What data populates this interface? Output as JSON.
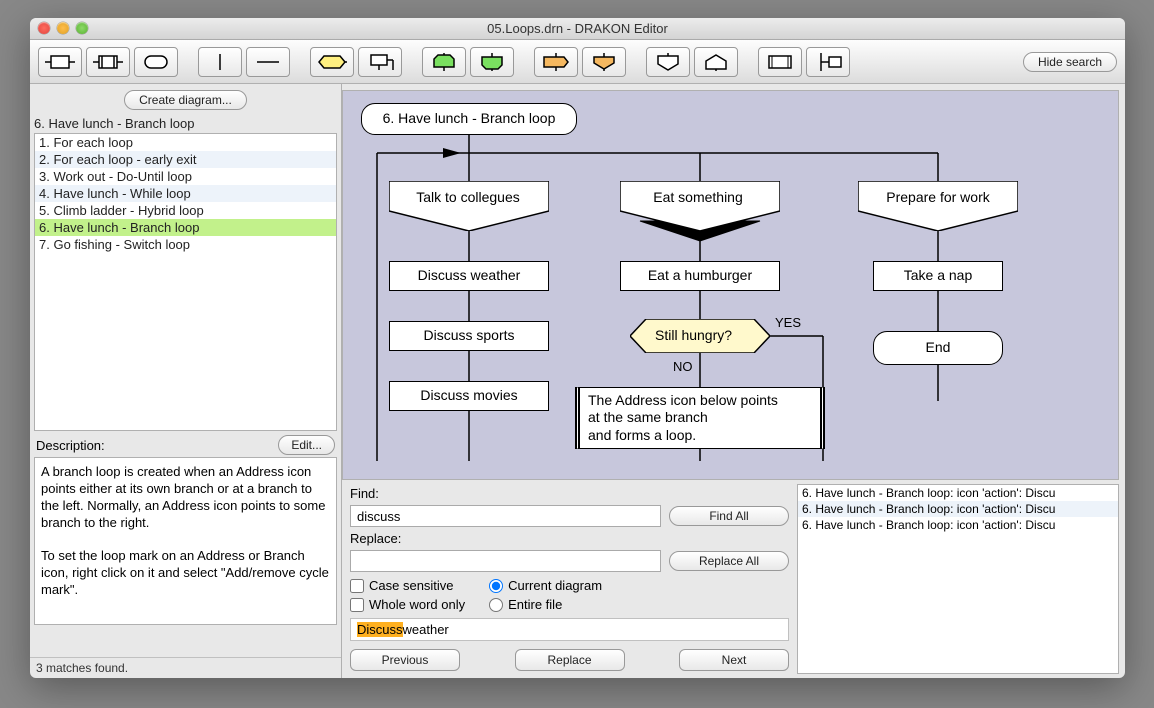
{
  "window": {
    "title": "05.Loops.drn - DRAKON Editor"
  },
  "toolbar": {
    "hide_search": "Hide search"
  },
  "sidebar": {
    "create_diagram": "Create diagram...",
    "filter": "6. Have lunch - Branch loop",
    "items": [
      "1. For each loop",
      "2. For each loop - early exit",
      "3. Work out - Do-Until loop",
      "4. Have lunch - While loop",
      "5. Climb ladder - Hybrid loop",
      "6. Have lunch - Branch loop",
      "7. Go fishing - Switch loop"
    ],
    "selected_index": 5,
    "description_label": "Description:",
    "edit_label": "Edit...",
    "description": "A branch loop is created when an Address icon points either at its own branch or at a branch to the left. Normally, an Address icon points to some branch to the right.\n\nTo set the loop mark on an Address or Branch icon, right click on it and select \"Add/remove cycle mark\"."
  },
  "status_bar": "3 matches found.",
  "diagram": {
    "title": "6. Have lunch - Branch loop",
    "branch1": {
      "head": "Talk to collegues",
      "a1": "Discuss weather",
      "a2": "Discuss sports",
      "a3": "Discuss movies"
    },
    "branch2": {
      "head": "Eat something",
      "a1": "Eat a humburger",
      "q": "Still hungry?",
      "yes": "YES",
      "no": "NO",
      "comment": "The Address icon below points\nat the same branch\nand forms a loop."
    },
    "branch3": {
      "head": "Prepare for work",
      "a1": "Take a nap",
      "end": "End"
    }
  },
  "find": {
    "find_label": "Find:",
    "find_value": "discuss",
    "replace_label": "Replace:",
    "replace_value": "",
    "find_all": "Find All",
    "replace_all": "Replace All",
    "case_sensitive": "Case sensitive",
    "whole_word": "Whole word only",
    "current_diagram": "Current diagram",
    "entire_file": "Entire file",
    "match_highlight": "Discuss",
    "match_rest": " weather",
    "prev": "Previous",
    "replace": "Replace",
    "next": "Next"
  },
  "results": [
    "6. Have lunch - Branch loop: icon 'action': Discu",
    "6. Have lunch - Branch loop: icon 'action': Discu",
    "6. Have lunch - Branch loop: icon 'action': Discu"
  ]
}
